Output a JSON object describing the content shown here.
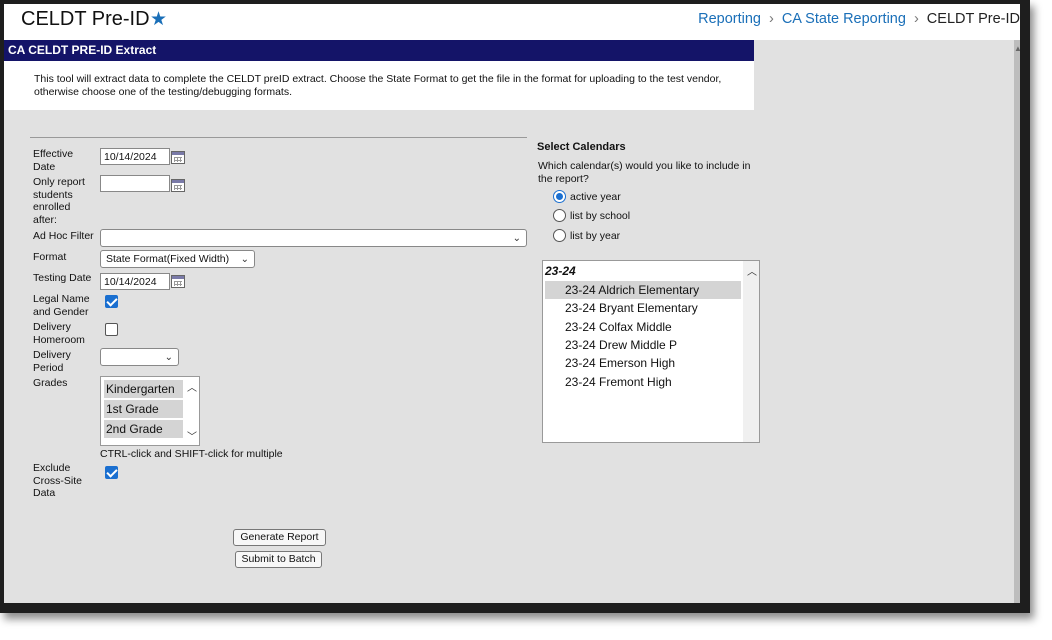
{
  "header": {
    "title": "CELDT Pre-ID",
    "breadcrumb": [
      "Reporting",
      "CA State Reporting",
      "CELDT Pre-ID"
    ]
  },
  "tool": {
    "title": "CA CELDT PRE-ID Extract",
    "description": "This tool will extract data to complete the CELDT preID extract. Choose the State Format to get the file in the format for uploading to the test vendor, otherwise choose one of the testing/debugging formats."
  },
  "form": {
    "effective_date_label": "Effective Date",
    "effective_date_value": "10/14/2024",
    "enrolled_after_label": "Only report students enrolled after:",
    "enrolled_after_value": "",
    "ad_hoc_label": "Ad Hoc Filter",
    "ad_hoc_value": "",
    "format_label": "Format",
    "format_value": "State Format(Fixed Width)",
    "testing_date_label": "Testing Date",
    "testing_date_value": "10/14/2024",
    "legal_name_label": "Legal Name and Gender",
    "legal_name_checked": true,
    "delivery_homeroom_label": "Delivery Homeroom",
    "delivery_homeroom_checked": false,
    "delivery_period_label": "Delivery Period",
    "delivery_period_value": "",
    "grades_label": "Grades",
    "grades": [
      "Kindergarten",
      "1st Grade",
      "2nd Grade"
    ],
    "grades_hint": "CTRL-click and SHIFT-click for multiple",
    "exclude_cross_site_label": "Exclude Cross-Site Data",
    "exclude_cross_site_checked": true,
    "generate_button": "Generate Report",
    "batch_button": "Submit to Batch"
  },
  "calendars": {
    "title": "Select Calendars",
    "question": "Which calendar(s) would you like to include in the report?",
    "options": [
      "active year",
      "list by school",
      "list by year"
    ],
    "selected_option": "active year",
    "group": "23-24",
    "items": [
      "23-24 Aldrich Elementary",
      "23-24 Bryant Elementary",
      "23-24 Colfax Middle",
      "23-24 Drew Middle P",
      "23-24 Emerson High",
      "23-24 Fremont High"
    ],
    "selected_item": "23-24 Aldrich Elementary"
  },
  "colors": {
    "title_bar": "#141468",
    "link": "#1a6fb8",
    "accent": "#1a6fd0",
    "panel_bg": "#e1e1e1"
  },
  "icons": [
    "star-icon",
    "calendar-icon",
    "chevron-down-icon",
    "checkmark-icon"
  ]
}
